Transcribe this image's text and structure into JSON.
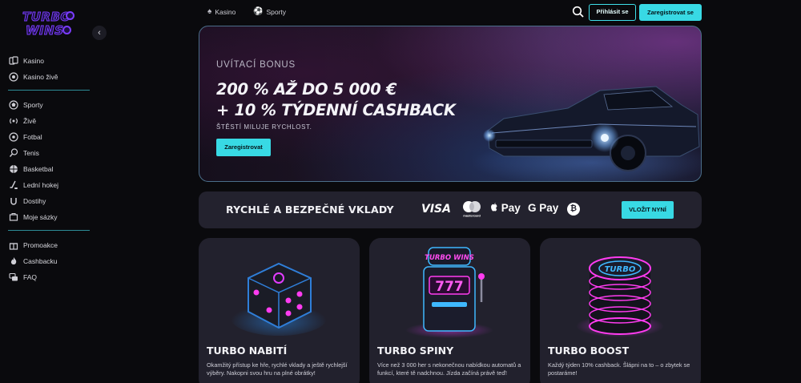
{
  "brand": {
    "logo_line1": "TURBO",
    "logo_line2": "WINS"
  },
  "colors": {
    "accent": "#38d9e4",
    "brand_purple": "#7b3cff",
    "background": "#0a0a0d",
    "panel": "#23222e"
  },
  "sidebar": {
    "groups": [
      [
        {
          "label": "Kasino",
          "icon": "casino-icon"
        },
        {
          "label": "Kasino živě",
          "icon": "live-casino-icon"
        }
      ],
      [
        {
          "label": "Sporty",
          "icon": "sports-icon"
        },
        {
          "label": "Živě",
          "icon": "live-icon"
        },
        {
          "label": "Fotbal",
          "icon": "football-icon"
        },
        {
          "label": "Tenis",
          "icon": "tennis-icon"
        },
        {
          "label": "Basketbal",
          "icon": "basketball-icon"
        },
        {
          "label": "Lední hokej",
          "icon": "ice-hockey-icon"
        },
        {
          "label": "Dostihy",
          "icon": "horse-racing-icon"
        },
        {
          "label": "Moje sázky",
          "icon": "my-bets-icon"
        }
      ],
      [
        {
          "label": "Promoakce",
          "icon": "gift-icon"
        },
        {
          "label": "Cashbacku",
          "icon": "flame-icon"
        },
        {
          "label": "FAQ",
          "icon": "faq-icon"
        }
      ]
    ]
  },
  "topbar": {
    "tabs": [
      {
        "label": "Kasino",
        "icon": "spade-icon"
      },
      {
        "label": "Sporty",
        "icon": "soccer-ball-icon"
      }
    ],
    "login_label": "Přihlásit se",
    "register_label": "Zaregistrovat se"
  },
  "hero": {
    "subtitle": "UVÍTACÍ BONUS",
    "title_line1": "200 % AŽ DO 5 000 €",
    "title_line2": "+ 10 % TÝDENNÍ CASHBACK",
    "tagline": "ŠTĚSTÍ MILUJE RYCHLOST.",
    "cta_label": "Zaregistrovat"
  },
  "payments": {
    "title": "RYCHLÉ A BEZPEČNÉ VKLADY",
    "methods": [
      "VISA",
      "mastercard",
      "Pay",
      "G Pay",
      "₿"
    ],
    "cta_label": "VLOŽIT NYNÍ"
  },
  "cards": [
    {
      "title": "TURBO NABITÍ",
      "description": "Okamžitý přístup ke hře, rychlé vklady a ještě rychlejší výběry. Nakopni svou hru na plné obrátky!"
    },
    {
      "title": "TURBO SPINY",
      "description": "Více než 3 000 her s nekonečnou nabídkou automatů a funkcí, které tě nadchnou. Jízda začíná právě teď!"
    },
    {
      "title": "TURBO BOOST",
      "description": "Každý týden 10% cashback. Šlápni na to – o zbytek se postaráme!",
      "chip_label": "TURBO"
    }
  ],
  "slot_machine": {
    "label": "TURBO WINS",
    "reels": "777"
  }
}
